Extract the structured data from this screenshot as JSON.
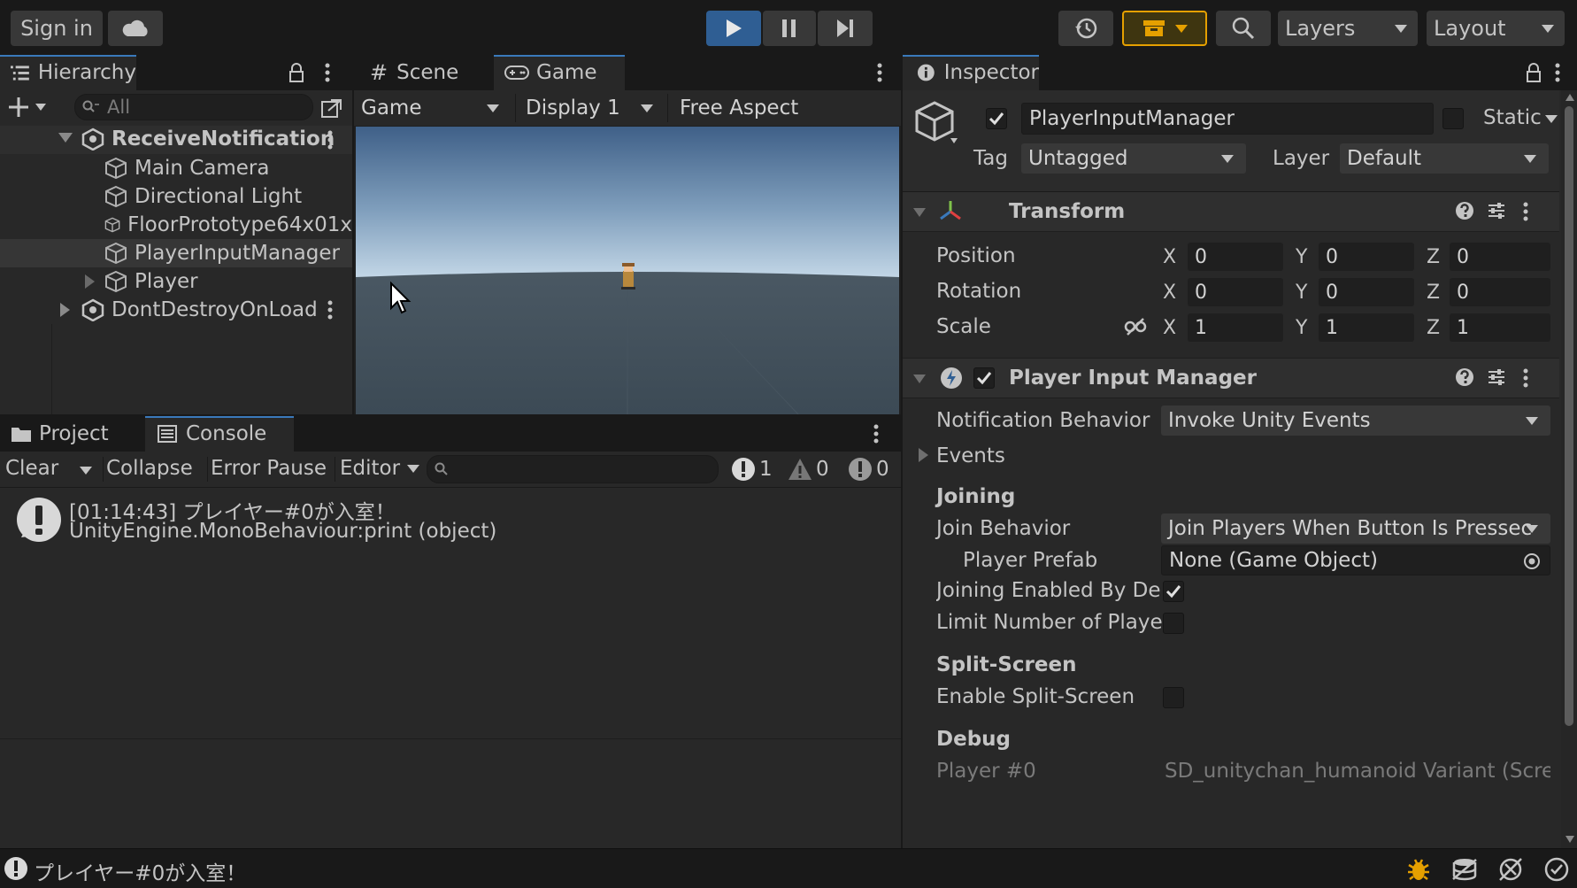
{
  "toolbar": {
    "sign_in": "Sign in",
    "layers": "Layers",
    "layout": "Layout"
  },
  "hierarchy": {
    "tab": "Hierarchy",
    "search_placeholder": "All",
    "items": [
      {
        "label": "ReceiveNotification"
      },
      {
        "label": "Main Camera"
      },
      {
        "label": "Directional Light"
      },
      {
        "label": "FloorPrototype64x01x"
      },
      {
        "label": "PlayerInputManager"
      },
      {
        "label": "Player"
      },
      {
        "label": "DontDestroyOnLoad"
      }
    ]
  },
  "scene_game": {
    "tabs": [
      "Scene",
      "Game"
    ],
    "game_dropdown": "Game",
    "display": "Display 1",
    "aspect": "Free Aspect"
  },
  "console": {
    "tabs": [
      "Project",
      "Console"
    ],
    "clear": "Clear",
    "collapse": "Collapse",
    "error_pause": "Error Pause",
    "editor": "Editor",
    "count_info": "1",
    "count_warn": "0",
    "count_error": "0",
    "entry_line1": "[01:14:43] プレイヤー#0が入室！",
    "entry_line2": "UnityEngine.MonoBehaviour:print (object)"
  },
  "inspector": {
    "tab": "Inspector",
    "object_name": "PlayerInputManager",
    "static_label": "Static",
    "tag_label": "Tag",
    "tag_value": "Untagged",
    "layer_label": "Layer",
    "layer_value": "Default",
    "transform": {
      "title": "Transform",
      "position_label": "Position",
      "rotation_label": "Rotation",
      "scale_label": "Scale",
      "axes": [
        "X",
        "Y",
        "Z"
      ],
      "position": [
        "0",
        "0",
        "0"
      ],
      "rotation": [
        "0",
        "0",
        "0"
      ],
      "scale": [
        "1",
        "1",
        "1"
      ]
    },
    "pim": {
      "title": "Player Input Manager",
      "notification_label": "Notification Behavior",
      "notification_value": "Invoke Unity Events",
      "events": "Events",
      "joining": "Joining",
      "join_behavior_label": "Join Behavior",
      "join_behavior_value": "Join Players When Button Is Pressec",
      "player_prefab_label": "Player Prefab",
      "player_prefab_value": "None (Game Object)",
      "joining_enabled_label": "Joining Enabled By De",
      "limit_label": "Limit Number of Player",
      "split_screen": "Split-Screen",
      "enable_split_label": "Enable Split-Screen",
      "debug": "Debug",
      "player0_label": "Player #0",
      "player0_value": "SD_unitychan_humanoid Variant (Scree"
    }
  },
  "status": {
    "message": "プレイヤー#0が入室！"
  },
  "colors": {
    "accent": "#3a79bb",
    "play_active": "#2f5e93",
    "collab": "#e5a000"
  }
}
